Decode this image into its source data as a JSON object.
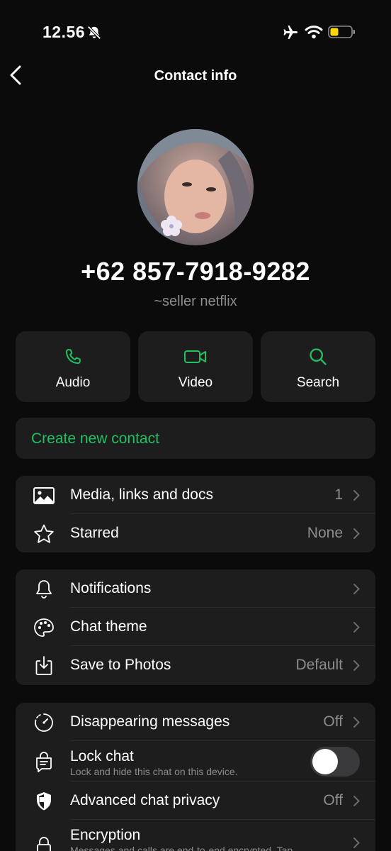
{
  "status_bar": {
    "time": "12.56",
    "icons": [
      "bell-off-icon",
      "airplane-icon",
      "wifi-icon",
      "battery-icon"
    ],
    "battery_color": "#ffd60a"
  },
  "nav": {
    "back_icon": "chevron-left-icon",
    "title": "Contact info"
  },
  "profile": {
    "phone": "+62 857-7918-9282",
    "name": "~seller netflix"
  },
  "actions": [
    {
      "label": "Audio",
      "icon": "phone-icon"
    },
    {
      "label": "Video",
      "icon": "video-icon"
    },
    {
      "label": "Search",
      "icon": "search-icon"
    }
  ],
  "create_contact": "Create new contact",
  "group1": [
    {
      "label": "Media, links and docs",
      "value": "1",
      "icon": "image-icon"
    },
    {
      "label": "Starred",
      "value": "None",
      "icon": "star-icon"
    }
  ],
  "group2": [
    {
      "label": "Notifications",
      "value": "",
      "icon": "bell-icon"
    },
    {
      "label": "Chat theme",
      "value": "",
      "icon": "palette-icon"
    },
    {
      "label": "Save to Photos",
      "value": "Default",
      "icon": "download-icon"
    }
  ],
  "group3": {
    "disappearing": {
      "label": "Disappearing messages",
      "value": "Off",
      "icon": "timer-icon"
    },
    "lock": {
      "label": "Lock chat",
      "sub": "Lock and hide this chat on this device.",
      "enabled": false,
      "icon": "lock-chat-icon"
    },
    "privacy": {
      "label": "Advanced chat privacy",
      "value": "Off",
      "icon": "shield-icon"
    },
    "encryption": {
      "label": "Encryption",
      "sub": "Messages and calls are end-to-end encrypted. Tap",
      "icon": "lock-icon"
    }
  },
  "colors": {
    "accent": "#21c063",
    "background": "#0b0b0b",
    "card": "#1d1d1d",
    "secondary_text": "#8d8d8d"
  }
}
